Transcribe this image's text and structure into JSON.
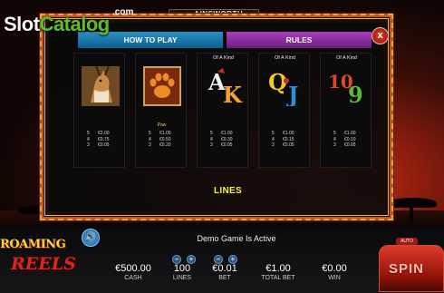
{
  "watermark": {
    "brand_part1": "Slot",
    "brand_part2": "Catalog",
    "com": ".com"
  },
  "provider": {
    "name": "AINSWORTH"
  },
  "tabs": [
    {
      "label": "HOW TO PLAY"
    },
    {
      "label": "RULES"
    }
  ],
  "close": {
    "icon": "close-icon",
    "glyph": "x"
  },
  "cards": [
    {
      "heading": "",
      "symbol": "antelope",
      "label": "",
      "pays": [
        {
          "count": "5",
          "value": "€2.00"
        },
        {
          "count": "4",
          "value": "€0.75"
        },
        {
          "count": "3",
          "value": "€0.05"
        }
      ]
    },
    {
      "heading": "",
      "symbol": "paw",
      "label": "Paw",
      "pays": [
        {
          "count": "5",
          "value": "€1.00"
        },
        {
          "count": "4",
          "value": "€0.50"
        },
        {
          "count": "3",
          "value": "€0.20"
        }
      ]
    },
    {
      "heading": "Of A Kind",
      "symbol": "A K",
      "label": "",
      "pays": [
        {
          "count": "5",
          "value": "€1.00"
        },
        {
          "count": "4",
          "value": "€0.30"
        },
        {
          "count": "3",
          "value": "€0.05"
        }
      ]
    },
    {
      "heading": "Of A Kind",
      "symbol": "Q J",
      "label": "",
      "pays": [
        {
          "count": "5",
          "value": "€1.00"
        },
        {
          "count": "4",
          "value": "€0.15"
        },
        {
          "count": "3",
          "value": "€0.05"
        }
      ]
    },
    {
      "heading": "Of A Kind",
      "symbol": "10 9",
      "label": "",
      "pays": [
        {
          "count": "5",
          "value": "€1.00"
        },
        {
          "count": "4",
          "value": "€0.10"
        },
        {
          "count": "3",
          "value": "€0.05"
        }
      ]
    }
  ],
  "section_label": "LINES",
  "status": "Demo Game Is Active",
  "game_logo": {
    "line1": "ROAMING",
    "line2": "REELS"
  },
  "stats": {
    "cash": {
      "value": "€500.00",
      "label": "CASH"
    },
    "lines": {
      "value": "100",
      "label": "LINES"
    },
    "bet": {
      "value": "€0.01",
      "label": "BET"
    },
    "total_bet": {
      "value": "€1.00",
      "label": "TOTAL BET"
    },
    "win": {
      "value": "€0.00",
      "label": "WIN"
    }
  },
  "steppers": {
    "minus": "−",
    "plus": "+"
  },
  "autoplay": {
    "label": "AUTO"
  },
  "spin": {
    "label": "SPIN"
  },
  "colors": {
    "tab_how": "#1a78ad",
    "tab_rules": "#8e2ea6",
    "frame": "#c1541c",
    "lines_label": "#f4f430",
    "symbol_gold": "#f3c84a",
    "spin": "#d62a1e"
  }
}
